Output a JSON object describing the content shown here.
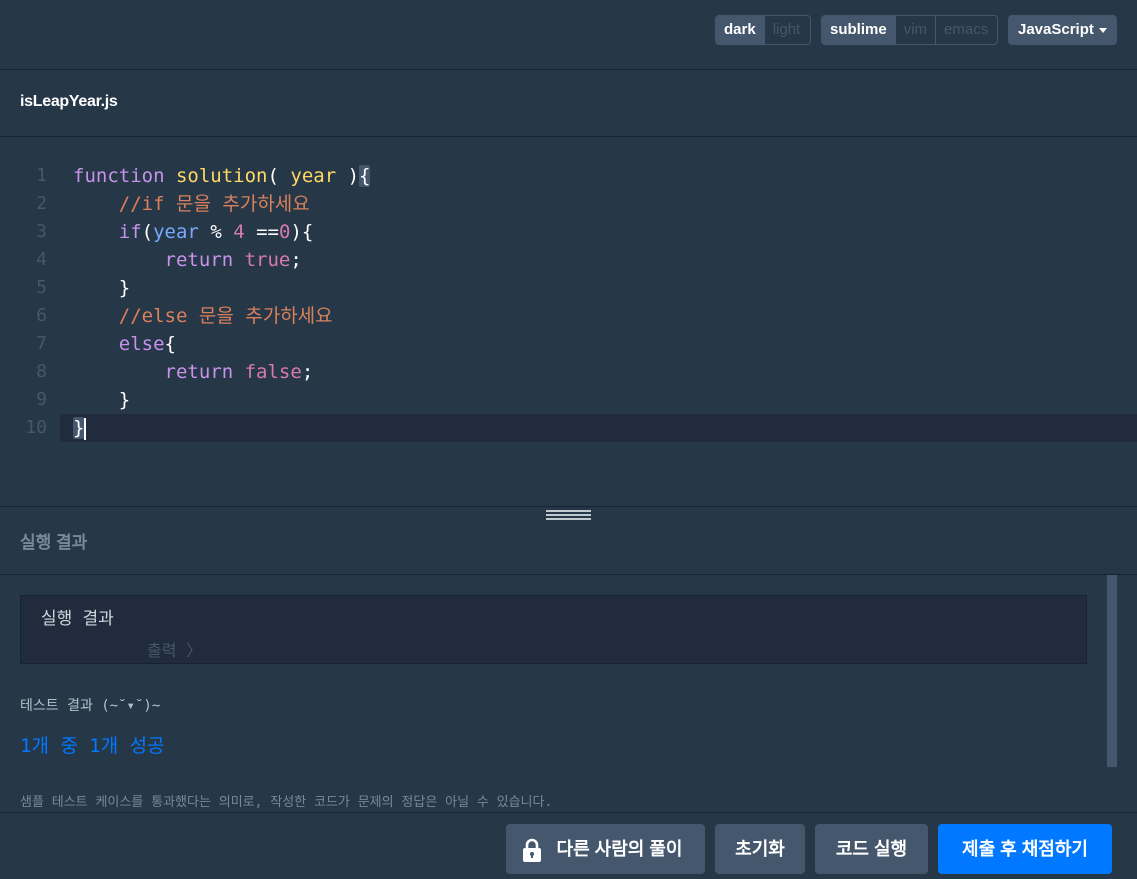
{
  "toolbar": {
    "theme_options": [
      "dark",
      "light"
    ],
    "theme_selected": "dark",
    "keymap_options": [
      "sublime",
      "vim",
      "emacs"
    ],
    "keymap_selected": "sublime",
    "language": "JavaScript"
  },
  "file": {
    "name": "isLeapYear.js"
  },
  "editor": {
    "line_numbers": [
      "1",
      "2",
      "3",
      "4",
      "5",
      "6",
      "7",
      "8",
      "9",
      "10"
    ],
    "active_line": 10
  },
  "result": {
    "header": "실행 결과",
    "box_title": "실행 결과",
    "output_label": "출력 〉",
    "test_title": "테스트 결과 (~˘▾˘)~",
    "test_count": "1개 중 1개 성공",
    "sample_note": "샘플 테스트 케이스를 통과했다는 의미로, 작성한 코드가 문제의 정답은 아닐 수 있습니다."
  },
  "buttons": {
    "solution": "다른 사람의 풀이",
    "reset": "초기화",
    "run": "코드 실행",
    "submit": "제출 후 채점하기"
  },
  "colors": {
    "background": "#263747",
    "accent": "#0078ff",
    "button": "#44576c"
  },
  "icons": {
    "solution_button": "lock-icon",
    "splitter": "drag-handle-icon"
  }
}
